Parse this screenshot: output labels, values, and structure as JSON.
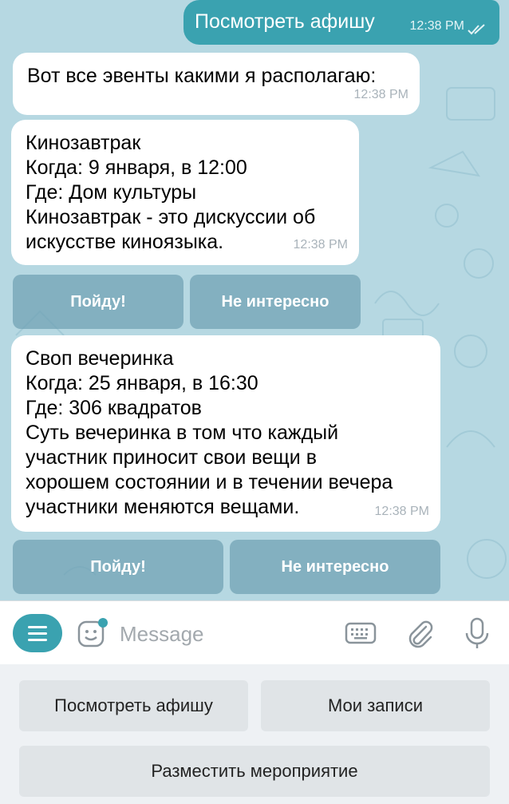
{
  "messages": {
    "outgoing": {
      "text": "Посмотреть афишу",
      "time": "12:38 PM"
    },
    "intro": {
      "text": "Вот все эвенты какими я располагаю:",
      "time": "12:38 PM"
    },
    "event1": {
      "title": "Кинозавтрак",
      "when": "Когда: 9 января, в 12:00",
      "where": "Где: Дом культуры",
      "desc_line1": "Кинозавтрак - это дискуссии об",
      "desc_line2": "искусстве киноязыка.",
      "time": "12:38 PM",
      "btn_go": "Пойду!",
      "btn_skip": "Не интересно"
    },
    "event2": {
      "title": "Своп вечеринка",
      "when": "Когда: 25 января, в 16:30",
      "where": "Где: 306 квадратов",
      "desc_line1": "Суть вечеринка в том что каждый",
      "desc_line2": "участник приносит свои вещи в",
      "desc_line3": "хорошем состоянии и в течении вечера",
      "desc_line4": "участники меняются вещами.",
      "time": "12:38 PM",
      "btn_go": "Пойду!",
      "btn_skip": "Не интересно"
    }
  },
  "input": {
    "placeholder": "Message"
  },
  "keyboard": {
    "btn1": "Посмотреть афишу",
    "btn2": "Мои записи",
    "btn3": "Разместить мероприятие"
  },
  "colors": {
    "accent": "#3aa2b0",
    "chat_bg": "#b6d8e2"
  }
}
